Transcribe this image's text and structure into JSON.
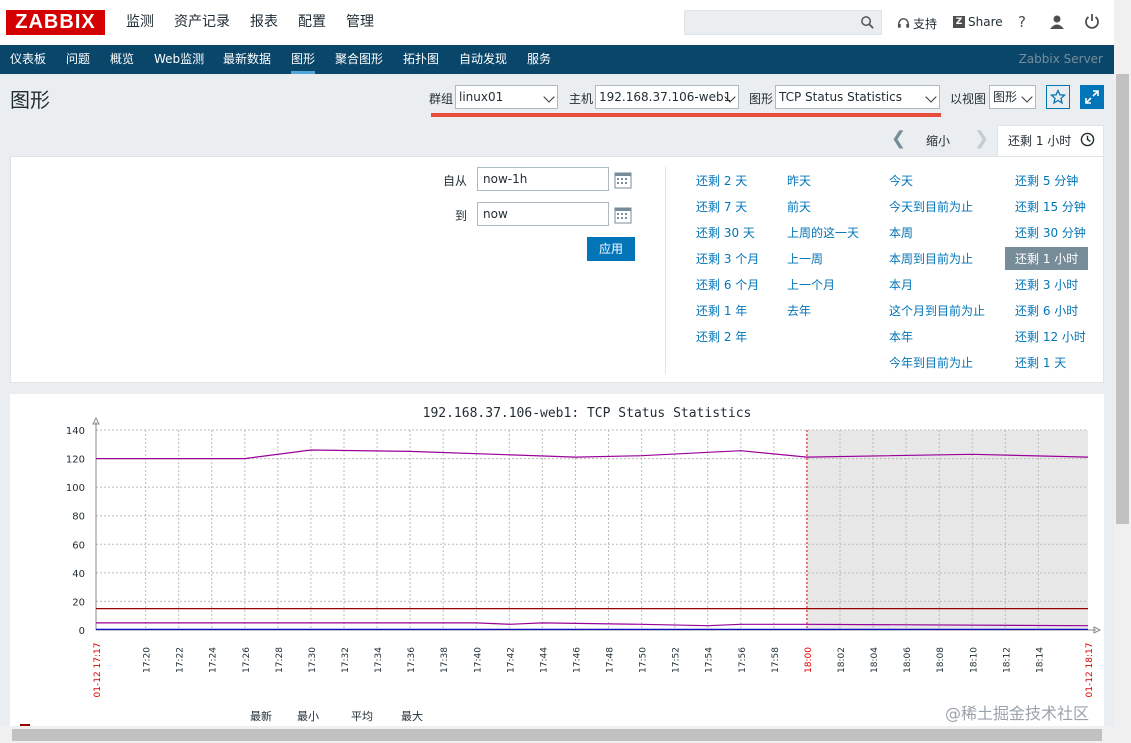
{
  "header": {
    "logo": "ZABBIX",
    "menu": [
      "监测",
      "资产记录",
      "报表",
      "配置",
      "管理"
    ],
    "active_menu": "监测",
    "support": "支持",
    "share": "Share",
    "help": "?"
  },
  "subnav": {
    "items": [
      "仪表板",
      "问题",
      "概览",
      "Web监测",
      "最新数据",
      "图形",
      "聚合图形",
      "拓扑图",
      "自动发现",
      "服务"
    ],
    "active": "图形",
    "server": "Zabbix Server"
  },
  "page": {
    "title": "图形",
    "group_label": "群组",
    "group_value": "linux01",
    "host_label": "主机",
    "host_value": "192.168.37.106-web1",
    "graph_label": "图形",
    "graph_value": "TCP Status Statistics",
    "view_label": "以视图",
    "view_value": "图形"
  },
  "timebar": {
    "zoom_out": "缩小",
    "active_tab": "还剩 1 小时"
  },
  "filter": {
    "from_label": "自从",
    "from_value": "now-1h",
    "to_label": "到",
    "to_value": "now",
    "apply": "应用",
    "quick": [
      [
        "还剩 2 天",
        "还剩 7 天",
        "还剩 30 天",
        "还剩 3 个月",
        "还剩 6 个月",
        "还剩 1 年",
        "还剩 2 年"
      ],
      [
        "昨天",
        "前天",
        "上周的这一天",
        "上一周",
        "上一个月",
        "去年"
      ],
      [
        "今天",
        "今天到目前为止",
        "本周",
        "本周到目前为止",
        "本月",
        "这个月到目前为止",
        "本年",
        "今年到目前为止"
      ],
      [
        "还剩 5 分钟",
        "还剩 15 分钟",
        "还剩 30 分钟",
        "还剩 1 小时",
        "还剩 3 小时",
        "还剩 6 小时",
        "还剩 12 小时",
        "还剩 1 天"
      ]
    ],
    "selected_quick": "还剩 1 小时"
  },
  "chart_data": {
    "type": "line",
    "title": "192.168.37.106-web1: TCP Status Statistics",
    "ylim": [
      0,
      140
    ],
    "yticks": [
      0,
      20,
      40,
      60,
      80,
      100,
      120,
      140
    ],
    "x_start_label": "01-12 17:17",
    "x_end_label": "01-12 18:17",
    "x_ticks": [
      "17:20",
      "17:22",
      "17:24",
      "17:26",
      "17:28",
      "17:30",
      "17:32",
      "17:34",
      "17:36",
      "17:38",
      "17:40",
      "17:42",
      "17:44",
      "17:46",
      "17:48",
      "17:50",
      "17:52",
      "17:54",
      "17:56",
      "17:58",
      "18:00",
      "18:02",
      "18:04",
      "18:06",
      "18:08",
      "18:10",
      "18:12",
      "18:14"
    ],
    "highlight_tick": "18:00",
    "shaded_from": "18:00",
    "series": [
      {
        "color": "#990099",
        "x": [
          17.17,
          17.26,
          17.3,
          17.36,
          17.46,
          17.5,
          17.56,
          18.0,
          18.1,
          18.17
        ],
        "values": [
          120,
          120,
          126,
          125,
          121,
          122,
          125.5,
          121,
          123,
          121
        ]
      },
      {
        "color": "#990000",
        "x": [
          17.17,
          18.17
        ],
        "values": [
          15,
          15
        ]
      },
      {
        "color": "#990099",
        "x": [
          17.17,
          17.4,
          17.42,
          17.44,
          17.5,
          17.54,
          17.56,
          18.0,
          18.17
        ],
        "values": [
          5,
          5,
          4,
          5,
          4,
          3,
          4,
          4,
          3
        ]
      },
      {
        "color": "#0000cc",
        "x": [
          17.17,
          18.17
        ],
        "values": [
          0.5,
          0.5
        ]
      }
    ],
    "legend_headers": [
      "最新",
      "最小",
      "平均",
      "最大"
    ]
  },
  "watermark": "@稀土掘金技术社区"
}
